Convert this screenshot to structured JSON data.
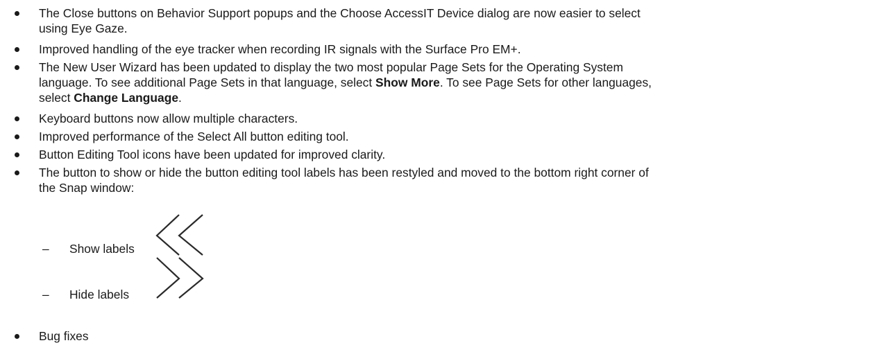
{
  "bullets": [
    {
      "lines": [
        "The Close buttons on Behavior Support popups and the Choose AccessIT Device dialog are now easier to select",
        "using Eye Gaze."
      ]
    },
    {
      "lines": [
        "Improved handling of the eye tracker when recording IR signals with the Surface Pro EM+."
      ]
    },
    {
      "line1": "The New User Wizard has been updated to display the two most popular Page Sets for the Operating System",
      "line2_a": "language. To see additional Page Sets in that language, select ",
      "line2_b": "Show More",
      "line2_c": ". To see Page Sets for other languages,",
      "line3_a": "select ",
      "line3_b": "Change Language",
      "line3_c": "."
    },
    {
      "lines": [
        "Keyboard buttons now allow multiple characters."
      ]
    },
    {
      "lines": [
        "Improved performance of the Select All button editing tool."
      ]
    },
    {
      "lines": [
        "Button Editing Tool icons have been updated for improved clarity."
      ]
    },
    {
      "lines": [
        "The button to show or hide the button editing tool labels has been restyled and moved to the bottom right corner of",
        "the Snap window:"
      ]
    },
    {
      "lines": [
        "Bug fixes"
      ]
    }
  ],
  "sub_items": {
    "dash": "–",
    "show_labels": "Show labels",
    "hide_labels": "Hide labels",
    "show_icon": "double-chevron-left-icon",
    "hide_icon": "double-chevron-right-icon"
  }
}
